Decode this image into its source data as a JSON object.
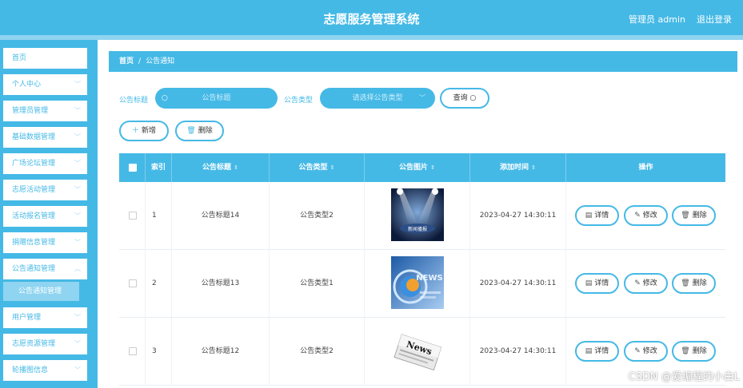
{
  "header": {
    "title": "志愿服务管理系统",
    "user": "管理员 admin",
    "logout": "退出登录"
  },
  "sidebar": {
    "items": [
      {
        "label": "首页",
        "chevron": false
      },
      {
        "label": "个人中心",
        "chevron": true
      },
      {
        "label": "管理员管理",
        "chevron": true
      },
      {
        "label": "基础数据管理",
        "chevron": true
      },
      {
        "label": "广场论坛管理",
        "chevron": true
      },
      {
        "label": "志愿活动管理",
        "chevron": true
      },
      {
        "label": "活动报名管理",
        "chevron": true
      },
      {
        "label": "捐赠信息管理",
        "chevron": true
      },
      {
        "label": "公告通知管理",
        "chevron": true
      },
      {
        "label": "用户管理",
        "chevron": true
      },
      {
        "label": "志愿资源管理",
        "chevron": true
      },
      {
        "label": "轮播图信息",
        "chevron": true
      }
    ],
    "submenu": {
      "label": "公告通知管理"
    }
  },
  "breadcrumb": {
    "home": "首页",
    "separator": "/",
    "current": "公告通知"
  },
  "search": {
    "title_label": "公告标题",
    "title_placeholder": "公告标题",
    "type_label": "公告类型",
    "type_placeholder": "请选择公告类型",
    "query_button": "查询"
  },
  "toolbar": {
    "add_label": "新增",
    "delete_label": "删除"
  },
  "table": {
    "headers": {
      "index": "索引",
      "title": "公告标题",
      "type": "公告类型",
      "image": "公告图片",
      "time": "添加时间",
      "ops": "操作"
    },
    "rows": [
      {
        "index": "1",
        "title": "公告标题14",
        "type": "公告类型2",
        "time": "2023-04-27 14:30:11"
      },
      {
        "index": "2",
        "title": "公告标题13",
        "type": "公告类型1",
        "time": "2023-04-27 14:30:11"
      },
      {
        "index": "3",
        "title": "公告标题12",
        "type": "公告类型2",
        "time": "2023-04-27 14:30:11"
      }
    ],
    "actions": {
      "detail": "详情",
      "edit": "修改",
      "delete": "删除"
    }
  },
  "thumb_text": [
    "新闻播报",
    "NEWS",
    "News"
  ],
  "watermark": "CSDN @爱编程的小白L",
  "colors": {
    "primary": "#45b9e6",
    "light": "#8fd4f0"
  }
}
